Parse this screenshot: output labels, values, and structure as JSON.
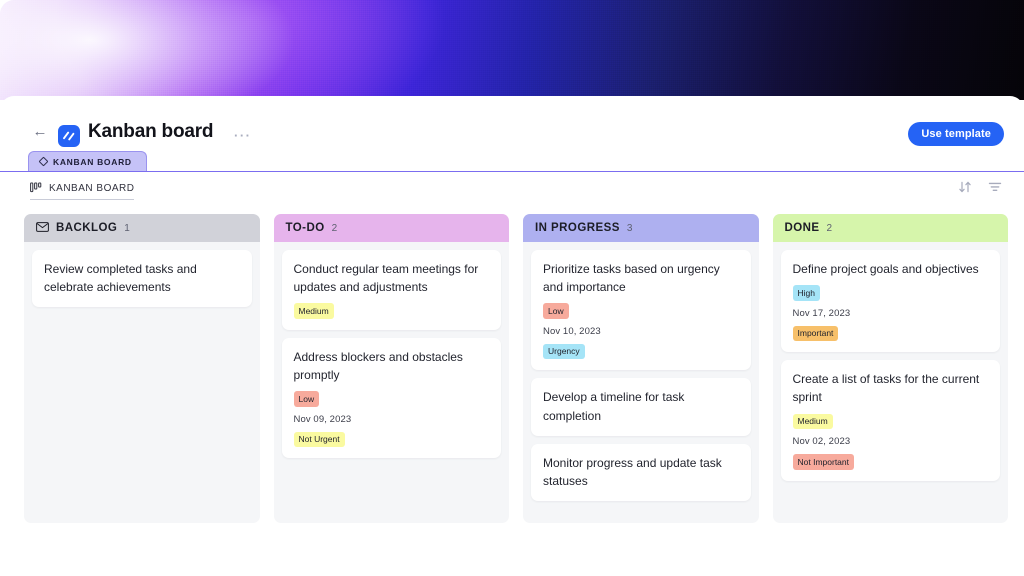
{
  "banner": {
    "gradient_from": "#f3e6fd",
    "gradient_mid": "#6a2bea",
    "gradient_to": "#050408"
  },
  "header": {
    "back_icon": "arrow-left-icon",
    "logo_icon": "brand-logo-icon",
    "title": "Kanban board",
    "more_label": "···",
    "use_template_label": "Use template",
    "accent_color": "#2563f5"
  },
  "tab": {
    "label": "KANBAN BOARD",
    "icon": "diamond-icon",
    "bg": "#c5c2f7",
    "border": "#7b6df0"
  },
  "subheader": {
    "label": "KANBAN BOARD",
    "icon": "board-columns-icon"
  },
  "toolbar": {
    "sort_icon": "sort-arrows-icon",
    "filter_icon": "filter-icon"
  },
  "board": {
    "columns": [
      {
        "name": "BACKLOG",
        "count": "1",
        "header_bg": "#d1d2d9",
        "icon": "envelope-icon",
        "cards": [
          {
            "title": "Review completed tasks and celebrate achievements",
            "date": null,
            "tags": []
          }
        ]
      },
      {
        "name": "TO-DO",
        "count": "2",
        "header_bg": "#e6b4ec",
        "icon": null,
        "cards": [
          {
            "title": " Conduct regular team meetings for updates and adjustments",
            "date": null,
            "tags": [
              {
                "label": "Medium",
                "color": "#fafaa0"
              }
            ]
          },
          {
            "title": "Address blockers and obstacles promptly",
            "date": "Nov 09, 2023",
            "tags": [
              {
                "label": "Low",
                "color": "#f7aa9c"
              },
              {
                "label": "Not Urgent",
                "color": "#fafaa0"
              }
            ]
          }
        ]
      },
      {
        "name": "IN PROGRESS",
        "count": "3",
        "header_bg": "#aeb0f0",
        "icon": null,
        "cards": [
          {
            "title": "Prioritize tasks based on urgency and importance",
            "date": "Nov 10, 2023",
            "tags": [
              {
                "label": "Low",
                "color": "#f7aa9c"
              },
              {
                "label": "Urgency",
                "color": "#a5e4f7"
              }
            ]
          },
          {
            "title": "Develop a timeline for task completion",
            "date": null,
            "tags": []
          },
          {
            "title": "Monitor progress and update task statuses",
            "date": null,
            "tags": []
          }
        ]
      },
      {
        "name": "DONE",
        "count": "2",
        "header_bg": "#d6f5ab",
        "icon": null,
        "cards": [
          {
            "title": "Define project goals and objectives",
            "date": "Nov 17, 2023",
            "tags": [
              {
                "label": "High",
                "color": "#a5e4f7"
              },
              {
                "label": "Important",
                "color": "#f7c06a"
              }
            ]
          },
          {
            "title": "Create a list of tasks for the current sprint",
            "date": "Nov 02, 2023",
            "tags": [
              {
                "label": "Medium",
                "color": "#fafaa0"
              },
              {
                "label": "Not Important",
                "color": "#f7aa9c"
              }
            ]
          }
        ]
      }
    ]
  }
}
